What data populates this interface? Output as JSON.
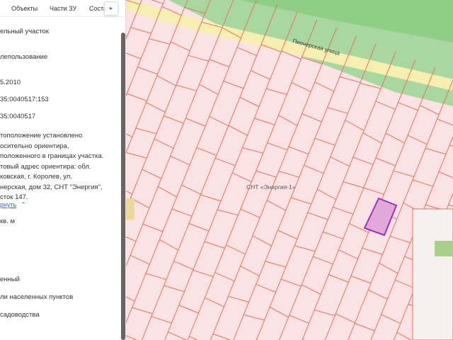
{
  "tabs": [
    "Объекты",
    "Части ЗУ",
    "Соста"
  ],
  "tab_next_icon": "chevron-right-icon",
  "fields": [
    "ельный участок",
    "лепользование",
    "5.2010",
    "35:0040517:153",
    "35:0040517"
  ],
  "address_lines": [
    "тоположение установлено",
    "осительно ориентира,",
    "положенного в границах участка.",
    "товый адрес ориентира: обл.",
    "ковская, г. Королев, ул.",
    "нерская, дом 32, СНТ \"Энергия\",",
    "сток 147."
  ],
  "collapse_link": "рнуть",
  "area": "кв. м",
  "fields2": [
    "енный",
    "ли населенных пунктов",
    "садоводства"
  ],
  "map": {
    "street_label": "Пионерская  улица",
    "snt_label": "СНТ «Энергия-1»",
    "colors": {
      "parcel_fill": "#fbe3e3",
      "parcel_line": "#e8705f",
      "highlight": "#9b2fc0",
      "green": "#a8d8a0",
      "road": "#f7efb0"
    }
  }
}
